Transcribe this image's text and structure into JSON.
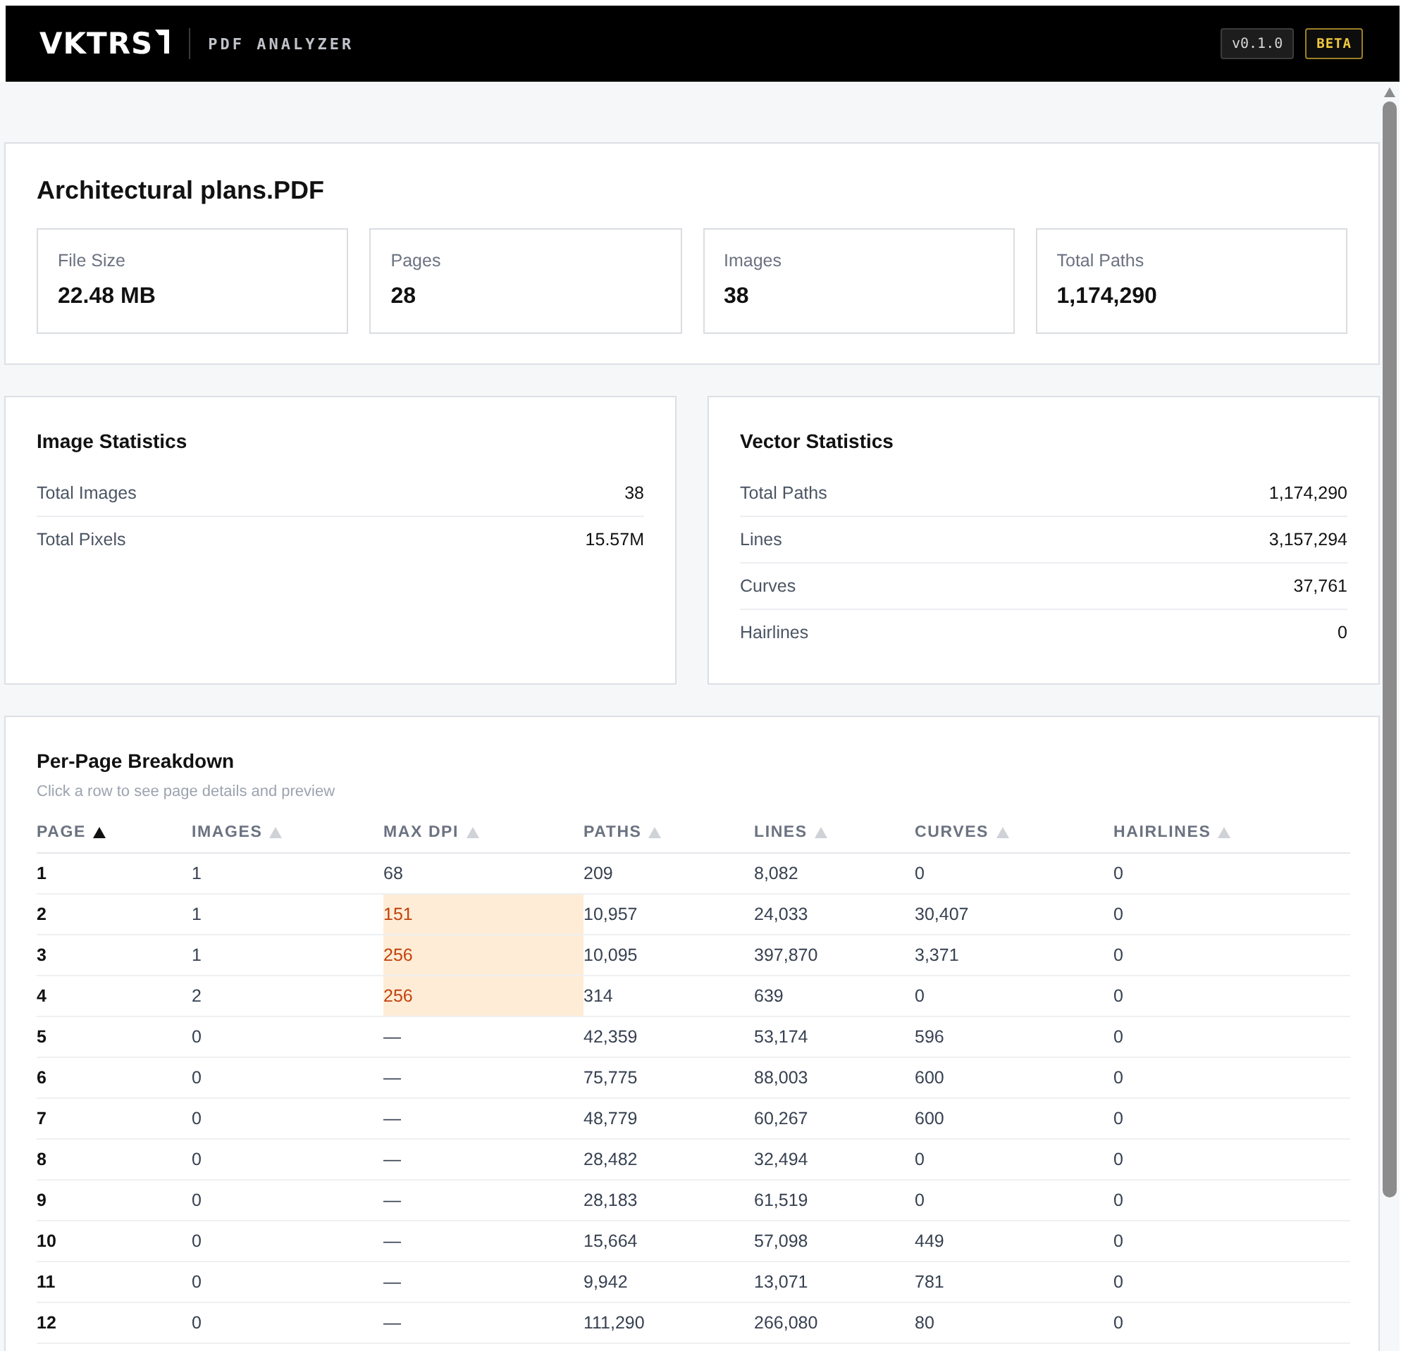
{
  "header": {
    "logo_text": "VKTRS",
    "product": "PDF ANALYZER",
    "version": "v0.1.0",
    "badge": "BETA"
  },
  "summary": {
    "title": "Architectural plans.PDF",
    "stats": [
      {
        "label": "File Size",
        "value": "22.48 MB"
      },
      {
        "label": "Pages",
        "value": "28"
      },
      {
        "label": "Images",
        "value": "38"
      },
      {
        "label": "Total Paths",
        "value": "1,174,290"
      }
    ]
  },
  "statistics": [
    {
      "title": "Image Statistics",
      "rows": [
        {
          "label": "Total Images",
          "value": "38"
        },
        {
          "label": "Total Pixels",
          "value": "15.57M"
        }
      ]
    },
    {
      "title": "Vector Statistics",
      "rows": [
        {
          "label": "Total Paths",
          "value": "1,174,290"
        },
        {
          "label": "Lines",
          "value": "3,157,294"
        },
        {
          "label": "Curves",
          "value": "37,761"
        },
        {
          "label": "Hairlines",
          "value": "0"
        }
      ]
    }
  ],
  "breakdown": {
    "title": "Per-Page Breakdown",
    "hint": "Click a row to see page details and preview",
    "columns": [
      {
        "label": "PAGE",
        "kind": "page",
        "sorted": true
      },
      {
        "label": "IMAGES",
        "kind": "count",
        "sorted": false
      },
      {
        "label": "MAX DPI",
        "kind": "dpi",
        "sorted": false
      },
      {
        "label": "PATHS",
        "kind": "count",
        "sorted": false
      },
      {
        "label": "LINES",
        "kind": "count",
        "sorted": false
      },
      {
        "label": "CURVES",
        "kind": "count",
        "sorted": false
      },
      {
        "label": "HAIRLINES",
        "kind": "count",
        "sorted": false
      }
    ],
    "rows": [
      {
        "cells": [
          "1",
          "1",
          "68",
          "209",
          "8,082",
          "0",
          "0"
        ],
        "dpi_warning": false
      },
      {
        "cells": [
          "2",
          "1",
          "151",
          "10,957",
          "24,033",
          "30,407",
          "0"
        ],
        "dpi_warning": true
      },
      {
        "cells": [
          "3",
          "1",
          "256",
          "10,095",
          "397,870",
          "3,371",
          "0"
        ],
        "dpi_warning": true
      },
      {
        "cells": [
          "4",
          "2",
          "256",
          "314",
          "639",
          "0",
          "0"
        ],
        "dpi_warning": true
      },
      {
        "cells": [
          "5",
          "0",
          "—",
          "42,359",
          "53,174",
          "596",
          "0"
        ],
        "dpi_warning": false
      },
      {
        "cells": [
          "6",
          "0",
          "—",
          "75,775",
          "88,003",
          "600",
          "0"
        ],
        "dpi_warning": false
      },
      {
        "cells": [
          "7",
          "0",
          "—",
          "48,779",
          "60,267",
          "600",
          "0"
        ],
        "dpi_warning": false
      },
      {
        "cells": [
          "8",
          "0",
          "—",
          "28,482",
          "32,494",
          "0",
          "0"
        ],
        "dpi_warning": false
      },
      {
        "cells": [
          "9",
          "0",
          "—",
          "28,183",
          "61,519",
          "0",
          "0"
        ],
        "dpi_warning": false
      },
      {
        "cells": [
          "10",
          "0",
          "—",
          "15,664",
          "57,098",
          "449",
          "0"
        ],
        "dpi_warning": false
      },
      {
        "cells": [
          "11",
          "0",
          "—",
          "9,942",
          "13,071",
          "781",
          "0"
        ],
        "dpi_warning": false
      },
      {
        "cells": [
          "12",
          "0",
          "—",
          "111,290",
          "266,080",
          "80",
          "0"
        ],
        "dpi_warning": false
      }
    ]
  }
}
